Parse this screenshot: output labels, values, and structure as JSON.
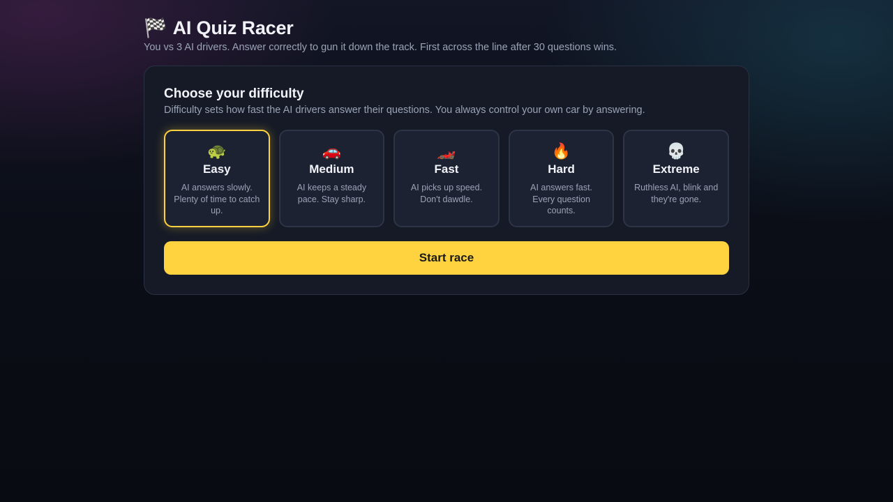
{
  "header": {
    "icon": "🏁",
    "title": "AI Quiz Racer",
    "subtitle": "You vs 3 AI drivers. Answer correctly to gun it down the track. First across the line after 30 questions wins."
  },
  "difficulty": {
    "title": "Choose your difficulty",
    "description": "Difficulty sets how fast the AI drivers answer their questions. You always control your own car by answering.",
    "selected": "Easy",
    "accent_color": "#ffd23f",
    "options": [
      {
        "icon": "🐢",
        "icon_name": "turtle-icon",
        "name": "Easy",
        "desc": "AI answers slowly. Plenty of time to catch up."
      },
      {
        "icon": "🚗",
        "icon_name": "car-icon",
        "name": "Medium",
        "desc": "AI keeps a steady pace. Stay sharp."
      },
      {
        "icon": "🏎️",
        "icon_name": "race-car-icon",
        "name": "Fast",
        "desc": "AI picks up speed. Don't dawdle."
      },
      {
        "icon": "🔥",
        "icon_name": "fire-icon",
        "name": "Hard",
        "desc": "AI answers fast. Every question counts."
      },
      {
        "icon": "💀",
        "icon_name": "skull-icon",
        "name": "Extreme",
        "desc": "Ruthless AI, blink and they're gone."
      }
    ]
  },
  "start_button": {
    "label": "Start race"
  }
}
